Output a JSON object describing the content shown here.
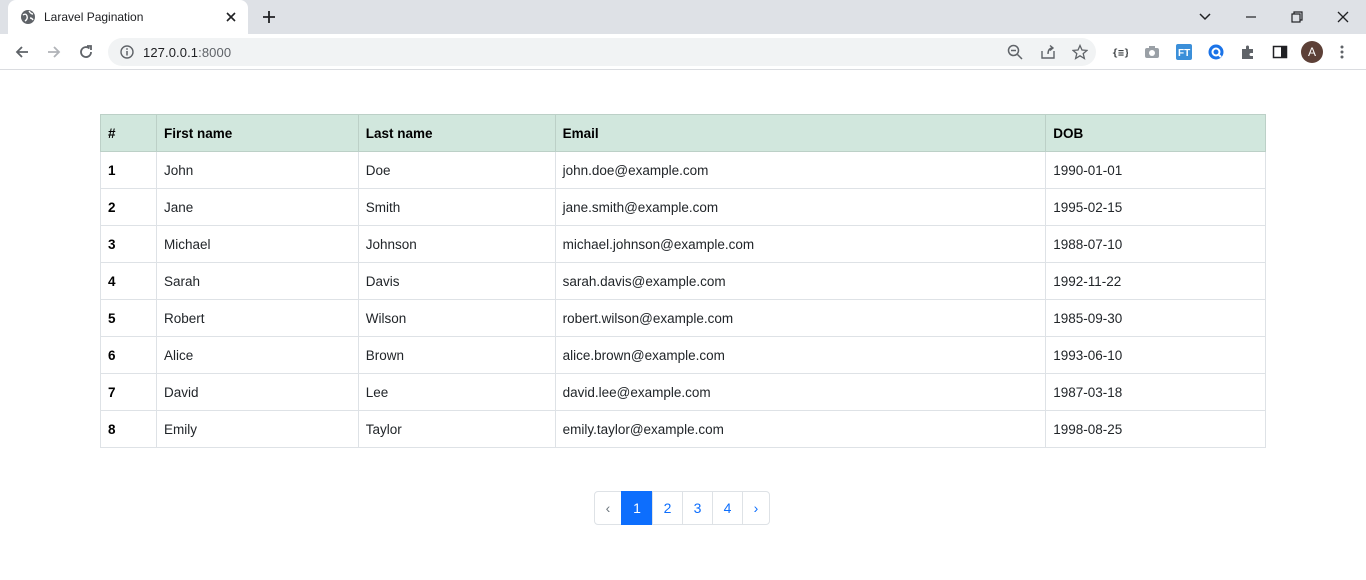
{
  "browser": {
    "tab_title": "Laravel Pagination",
    "url_host": "127.0.0.1",
    "url_port": ":8000",
    "avatar_letter": "A"
  },
  "table": {
    "headers": [
      "#",
      "First name",
      "Last name",
      "Email",
      "DOB"
    ],
    "rows": [
      {
        "id": "1",
        "first": "John",
        "last": "Doe",
        "email": "john.doe@example.com",
        "dob": "1990-01-01"
      },
      {
        "id": "2",
        "first": "Jane",
        "last": "Smith",
        "email": "jane.smith@example.com",
        "dob": "1995-02-15"
      },
      {
        "id": "3",
        "first": "Michael",
        "last": "Johnson",
        "email": "michael.johnson@example.com",
        "dob": "1988-07-10"
      },
      {
        "id": "4",
        "first": "Sarah",
        "last": "Davis",
        "email": "sarah.davis@example.com",
        "dob": "1992-11-22"
      },
      {
        "id": "5",
        "first": "Robert",
        "last": "Wilson",
        "email": "robert.wilson@example.com",
        "dob": "1985-09-30"
      },
      {
        "id": "6",
        "first": "Alice",
        "last": "Brown",
        "email": "alice.brown@example.com",
        "dob": "1993-06-10"
      },
      {
        "id": "7",
        "first": "David",
        "last": "Lee",
        "email": "david.lee@example.com",
        "dob": "1987-03-18"
      },
      {
        "id": "8",
        "first": "Emily",
        "last": "Taylor",
        "email": "emily.taylor@example.com",
        "dob": "1998-08-25"
      }
    ]
  },
  "pagination": {
    "prev": "‹",
    "next": "›",
    "pages": [
      "1",
      "2",
      "3",
      "4"
    ],
    "current": "1"
  },
  "colors": {
    "header_bg": "#d1e7dd",
    "active_page": "#0d6efd"
  }
}
